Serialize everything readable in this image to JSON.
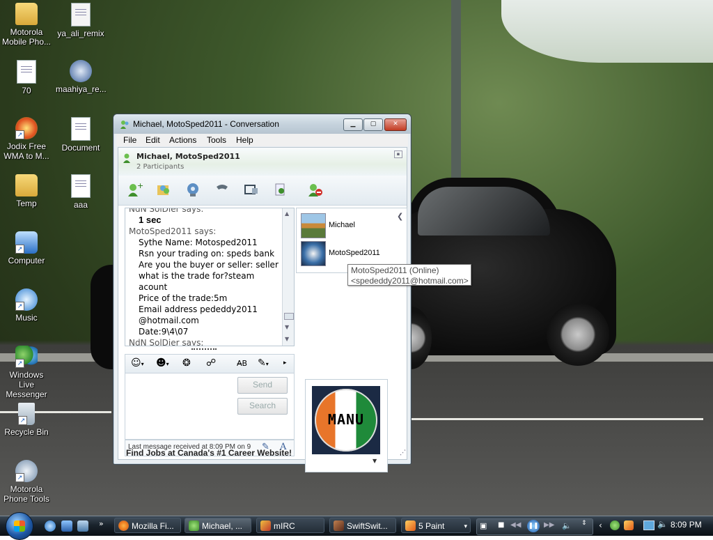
{
  "desktop_icons": [
    {
      "label": "Motorola Mobile Pho...",
      "type": "folder"
    },
    {
      "label": "ya_ali_remix",
      "type": "mp3"
    },
    {
      "label": "70",
      "type": "document"
    },
    {
      "label": "maahiya_re...",
      "type": "media"
    },
    {
      "label": "Jodix Free WMA to M...",
      "type": "app"
    },
    {
      "label": "Document",
      "type": "document"
    },
    {
      "label": "Temp",
      "type": "folder"
    },
    {
      "label": "aaa",
      "type": "document"
    },
    {
      "label": "Computer",
      "type": "computer"
    },
    {
      "label": "Music",
      "type": "music"
    },
    {
      "label": "Windows Live Messenger",
      "type": "messenger"
    },
    {
      "label": "Recycle Bin",
      "type": "recycle"
    },
    {
      "label": "Motorola Phone Tools",
      "type": "app"
    }
  ],
  "window": {
    "title": "Michael, MotoSped2011 - Conversation",
    "menu": [
      "File",
      "Edit",
      "Actions",
      "Tools",
      "Help"
    ],
    "header_name": "Michael, MotoSped2011",
    "header_sub": "2 Participants",
    "toolbar_icons": [
      "invite-contact-icon",
      "share-files-icon",
      "video-call-icon",
      "call-icon",
      "games-icon",
      "activities-icon",
      "block-icon"
    ],
    "chat_lines": [
      {
        "kind": "says",
        "text": "NdN SolDier says:"
      },
      {
        "kind": "bold",
        "text": "1 sec"
      },
      {
        "kind": "says",
        "text": "MotoSped2011 says:"
      },
      {
        "kind": "msg",
        "text": "Sythe Name: Motosped2011"
      },
      {
        "kind": "msg",
        "text": "Rsn your trading on: speds bank"
      },
      {
        "kind": "msg",
        "text": "Are you the buyer or seller: seller"
      },
      {
        "kind": "msg",
        "text": "what is the trade for?steam acount"
      },
      {
        "kind": "msg",
        "text": "Price of the trade:5m"
      },
      {
        "kind": "msg",
        "text": "Email address pededdy2011"
      },
      {
        "kind": "msg",
        "text": "@hotmail.com"
      },
      {
        "kind": "msg",
        "text": "Date:9\\4\\07"
      },
      {
        "kind": "says",
        "text": "NdN SolDier says:"
      },
      {
        "kind": "bold",
        "text": "just paste"
      }
    ],
    "participants": [
      {
        "name": "Michael"
      },
      {
        "name": "MotoSped2011"
      }
    ],
    "tooltip_line1": "MotoSped2011 (Online)",
    "tooltip_line2": "<spededdy2011@hotmail.com>",
    "send_label": "Send",
    "search_label": "Search",
    "last_message": "Last message received at 8:09 PM on 9",
    "my_picture_text": "MANU",
    "ad_text": "Find Jobs at Canada's #1 Career Website!"
  },
  "taskbar": {
    "buttons": [
      {
        "label": "Mozilla Fi...",
        "icon": "firefox-icon",
        "color": "#e8731a"
      },
      {
        "label": "Michael, ...",
        "icon": "messenger-icon",
        "color": "#5fb34a"
      },
      {
        "label": "mIRC",
        "icon": "mirc-icon",
        "color": "#c0392b"
      },
      {
        "label": "SwiftSwit...",
        "icon": "swiftswitch-icon",
        "color": "#7a3b2a"
      },
      {
        "label": "5 Paint",
        "icon": "paint-icon",
        "color": "#e0a030"
      }
    ],
    "clock": "8:09 PM"
  },
  "colors": {
    "accent": "#1f5aa8",
    "taskbar": "#1a232c",
    "window_frame": "#c6d3dd"
  }
}
